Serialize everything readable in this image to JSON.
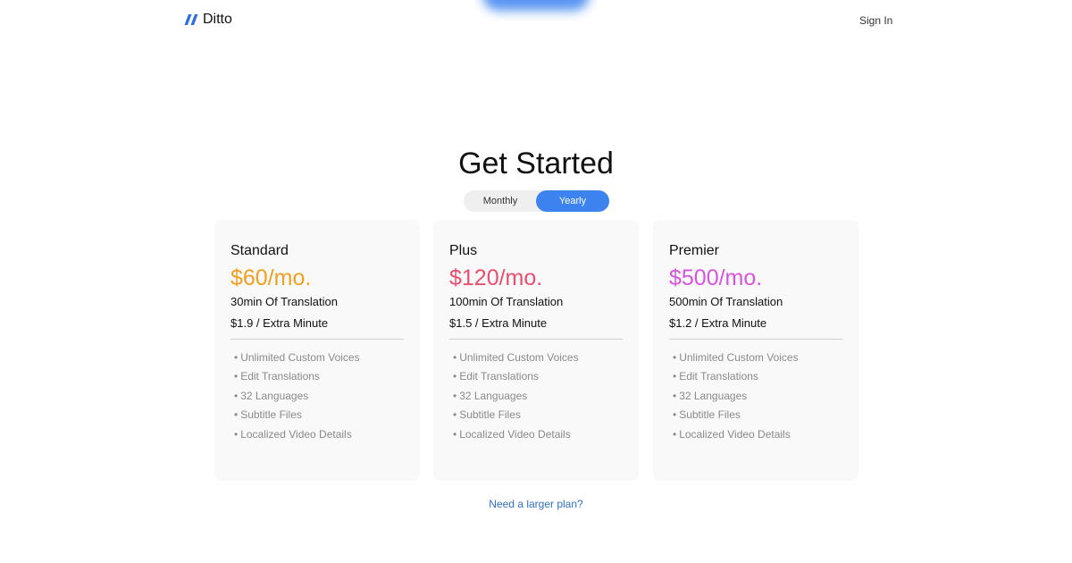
{
  "header": {
    "logo_text": "Ditto",
    "logo_icon": "double-slash-icon",
    "signin_label": "Sign In"
  },
  "main": {
    "title": "Get Started",
    "billing_toggle": {
      "monthly_label": "Monthly",
      "yearly_label": "Yearly",
      "selected": "Yearly"
    },
    "plans": [
      {
        "name": "Standard",
        "price": "$60/mo.",
        "price_color": "#f0a020",
        "minutes": "30min Of Translation",
        "extra": "$1.9 / Extra Minute",
        "features": [
          "Unlimited Custom Voices",
          "Edit Translations",
          "32 Languages",
          "Subtitle Files",
          "Localized Video Details"
        ]
      },
      {
        "name": "Plus",
        "price": "$120/mo.",
        "price_color": "#ea4e6e",
        "minutes": "100min Of Translation",
        "extra": "$1.5 / Extra Minute",
        "features": [
          "Unlimited Custom Voices",
          "Edit Translations",
          "32 Languages",
          "Subtitle Files",
          "Localized Video Details"
        ]
      },
      {
        "name": "Premier",
        "price": "$500/mo.",
        "price_color": "#d954de",
        "minutes": "500min Of Translation",
        "extra": "$1.2 / Extra Minute",
        "features": [
          "Unlimited Custom Voices",
          "Edit Translations",
          "32 Languages",
          "Subtitle Files",
          "Localized Video Details"
        ]
      }
    ],
    "larger_plan_link": "Need a larger plan?"
  },
  "colors": {
    "accent": "#3d83f0",
    "link": "#2f6fc8",
    "card_bg": "#f9f9f9"
  }
}
